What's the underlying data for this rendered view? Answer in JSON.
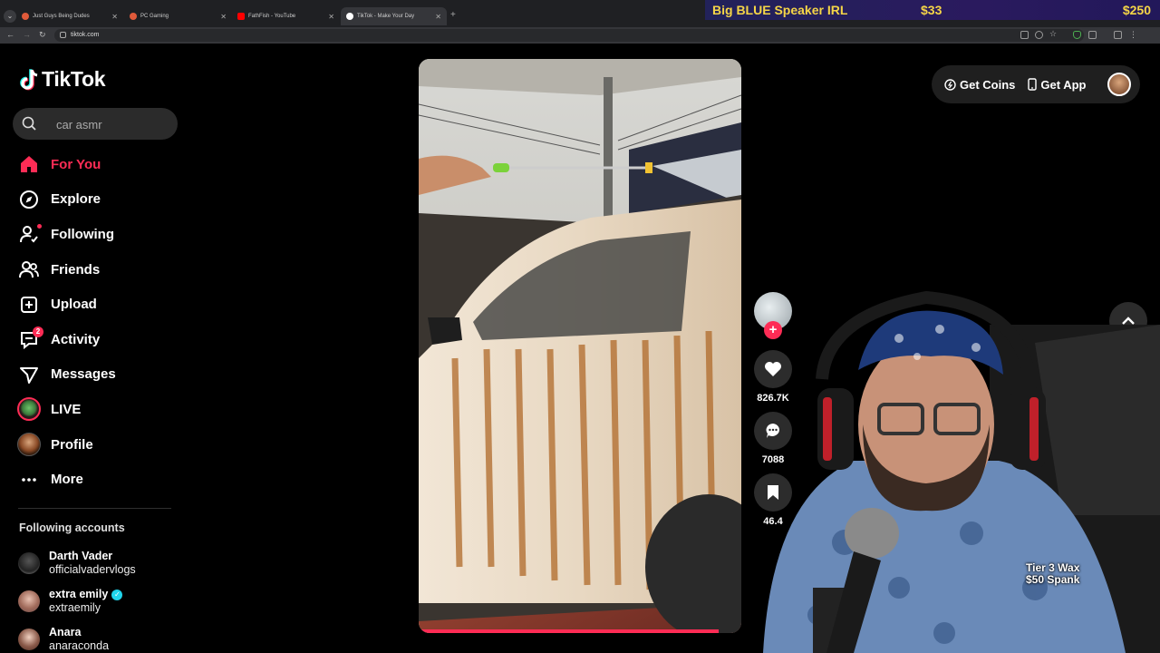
{
  "browser": {
    "tabs": [
      {
        "title": "Just Guys Being Dudes",
        "fav_color": "#e05a3a"
      },
      {
        "title": "PC Gaming",
        "fav_color": "#e05a3a"
      },
      {
        "title": "FathFish - YouTube",
        "fav_color": "#ff0000"
      },
      {
        "title": "TikTok - Make Your Day",
        "fav_color": "#ffffff"
      }
    ],
    "url": "tiktok.com"
  },
  "banner": {
    "title": "Big BLUE Speaker IRL",
    "price1": "$33",
    "price2": "$250"
  },
  "app": {
    "name": "TikTok"
  },
  "search": {
    "value": "car asmr"
  },
  "nav": [
    {
      "label": "For You",
      "icon": "home-icon"
    },
    {
      "label": "Explore",
      "icon": "compass-icon"
    },
    {
      "label": "Following",
      "icon": "following-icon"
    },
    {
      "label": "Friends",
      "icon": "friends-icon"
    },
    {
      "label": "Upload",
      "icon": "upload-icon"
    },
    {
      "label": "Activity",
      "icon": "activity-icon",
      "badge": "2"
    },
    {
      "label": "Messages",
      "icon": "messages-icon"
    },
    {
      "label": "LIVE",
      "icon": "live-avatar"
    },
    {
      "label": "Profile",
      "icon": "profile-avatar"
    },
    {
      "label": "More",
      "icon": "more-icon"
    }
  ],
  "following_title": "Following accounts",
  "accounts": [
    {
      "name": "Darth Vader",
      "handle": "officialvadervlogs"
    },
    {
      "name": "extra emily",
      "handle": "extraemily"
    },
    {
      "name": "Anara",
      "handle": "anaraconda"
    }
  ],
  "actions": {
    "likes": "826.7K",
    "comments": "7088",
    "saves": "46.4"
  },
  "topright": {
    "coins": "Get Coins",
    "app": "Get App"
  },
  "webcam": {
    "line1": "Tier 3 Wax",
    "line2": "$50 Spank"
  },
  "colors": {
    "accent": "#fe2c55",
    "verified": "#20d5ec"
  }
}
